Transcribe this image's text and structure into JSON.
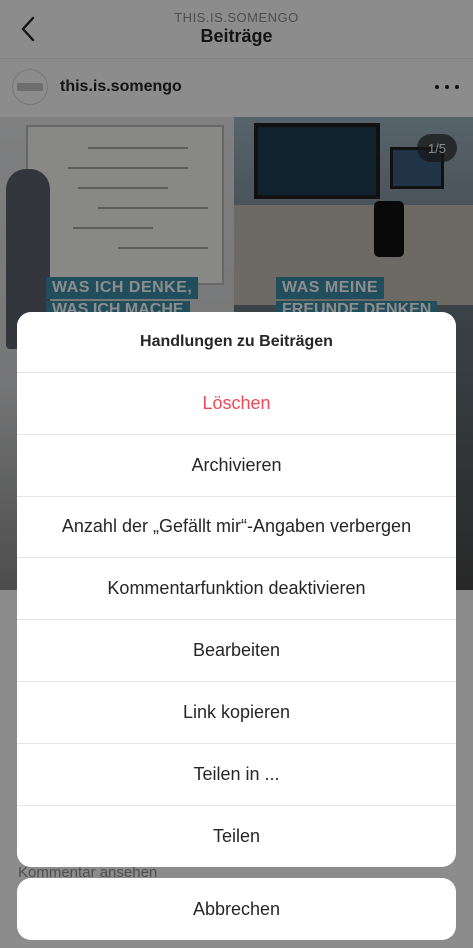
{
  "header": {
    "account": "THIS.IS.SOMENGO",
    "title": "Beiträge"
  },
  "post": {
    "username": "this.is.somengo",
    "counter": "1/5",
    "banner_left": "WAS ICH DENKE,",
    "banner_left_2": "WAS ICH MACHE",
    "banner_right": "WAS MEINE",
    "banner_right_2": "FREUNDE DENKEN",
    "view_comments": "Kommentar ansehen"
  },
  "sheet": {
    "title": "Handlungen zu Beiträgen",
    "items": [
      {
        "label": "Löschen"
      },
      {
        "label": "Archivieren"
      },
      {
        "label": "Anzahl der „Gefällt mir“-Angaben verbergen"
      },
      {
        "label": "Kommentarfunktion deaktivieren"
      },
      {
        "label": "Bearbeiten"
      },
      {
        "label": "Link kopieren"
      },
      {
        "label": "Teilen in ..."
      },
      {
        "label": "Teilen"
      }
    ],
    "cancel_label": "Abbrechen"
  },
  "colors": {
    "danger": "#ed4956",
    "text": "#262626",
    "banner": "#3d8fa8"
  },
  "icons": {
    "back": "chevron-left-icon",
    "more": "more-horizontal-icon"
  }
}
